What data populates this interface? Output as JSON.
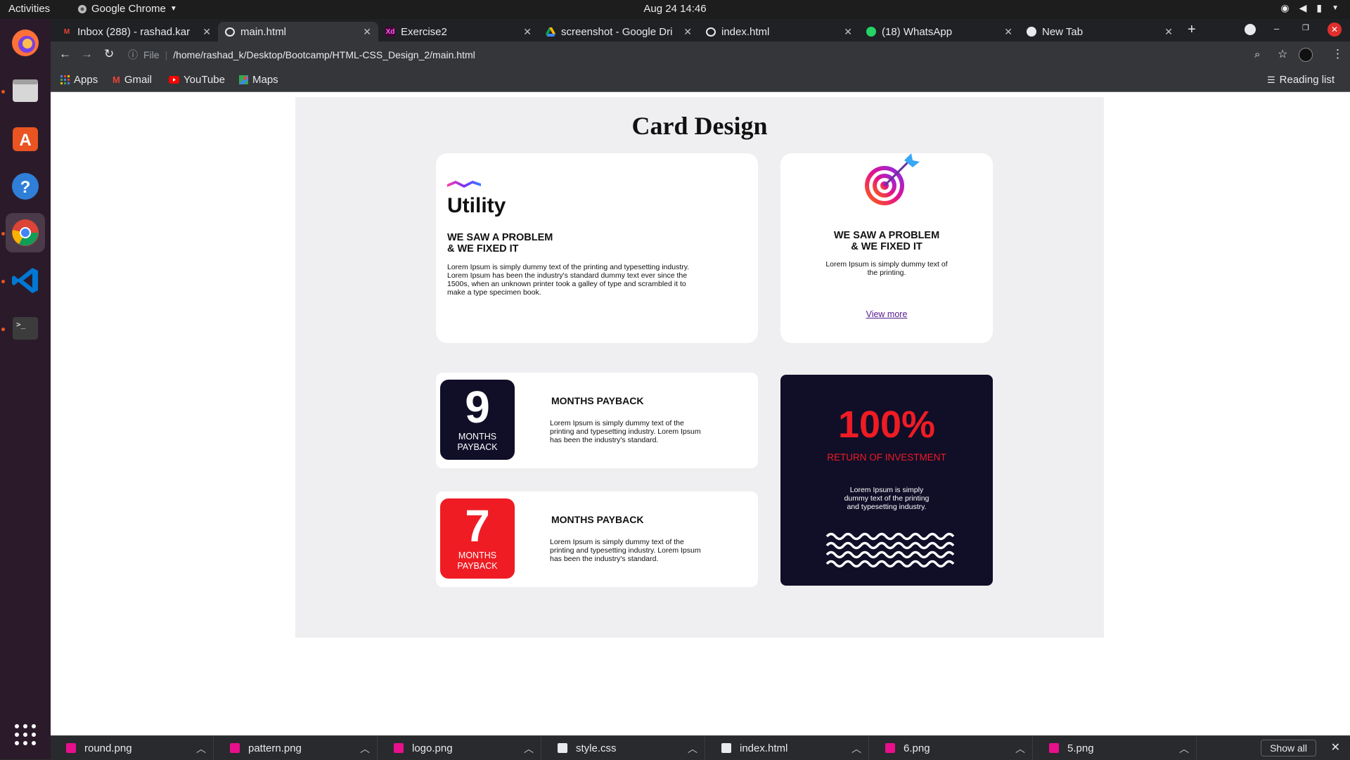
{
  "system": {
    "activities": "Activities",
    "app_name": "Google Chrome",
    "clock": "Aug 24  14:46"
  },
  "tabs": [
    {
      "label": "Inbox (288) - rashad.kar",
      "icon": "gmail-icon",
      "active": false
    },
    {
      "label": "main.html",
      "icon": "globe-icon",
      "active": true
    },
    {
      "label": "Exercise2",
      "icon": "xd-icon",
      "active": false
    },
    {
      "label": "screenshot - Google Dri",
      "icon": "drive-icon",
      "active": false
    },
    {
      "label": "index.html",
      "icon": "globe-icon",
      "active": false
    },
    {
      "label": "(18) WhatsApp",
      "icon": "whatsapp-icon",
      "active": false
    },
    {
      "label": "New Tab",
      "icon": "chrome-icon",
      "active": false
    }
  ],
  "address_bar": {
    "scheme_label": "File",
    "url": "/home/rashad_k/Desktop/Bootcamp/HTML-CSS_Design_2/main.html"
  },
  "bookmarks": {
    "items": [
      "Apps",
      "Gmail",
      "YouTube",
      "Maps"
    ],
    "reading_list": "Reading list"
  },
  "page": {
    "title": "Card Design",
    "card1": {
      "logo": "Utility",
      "heading_line1": "WE SAW A PROBLEM",
      "heading_line2": "& WE FIXED IT",
      "body_lines": [
        "Lorem Ipsum is simply dummy text of the printing and typesetting industry.",
        "Lorem Ipsum has been the industry's standard dummy text ever since the",
        "1500s, when an unknown printer took a galley of type and scrambled it to",
        "make a type specimen book."
      ]
    },
    "card2": {
      "heading_line1": "WE SAW A PROBLEM",
      "heading_line2": "& WE FIXED IT",
      "body_line1": "Lorem Ipsum is simply dummy text of",
      "body_line2": "the printing.",
      "link": "View more"
    },
    "card3": {
      "number": "9",
      "box_line1": "MONTHS",
      "box_line2": "PAYBACK",
      "box_color": "#110e28",
      "heading": "MONTHS PAYBACK",
      "body_lines": [
        "Lorem Ipsum is simply dummy text of the",
        "printing and typesetting industry. Lorem Ipsum",
        "has been the industry's standard."
      ]
    },
    "card4": {
      "number": "7",
      "box_line1": "MONTHS",
      "box_line2": "PAYBACK",
      "box_color": "#ef1c24",
      "heading": "MONTHS PAYBACK",
      "body_lines": [
        "Lorem Ipsum is simply dummy text of the",
        "printing and typesetting industry. Lorem Ipsum",
        "has been the industry's standard."
      ]
    },
    "card5": {
      "percent": "100%",
      "label": "RETURN OF INVESTMENT",
      "body_lines": [
        "Lorem Ipsum is simply",
        "dummy text of the printing",
        "and typesetting industry."
      ],
      "accent": "#ef1c24",
      "background": "#110e28"
    }
  },
  "downloads": {
    "items": [
      "round.png",
      "pattern.png",
      "logo.png",
      "style.css",
      "index.html",
      "6.png",
      "5.png"
    ],
    "show_all": "Show all"
  }
}
